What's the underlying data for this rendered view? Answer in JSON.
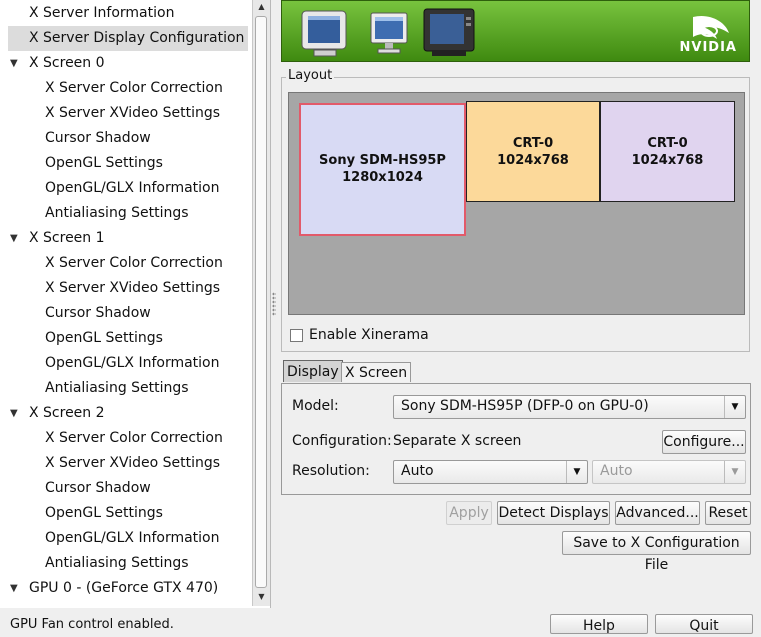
{
  "tree": {
    "items": [
      {
        "label": "X Server Information",
        "level": 1,
        "expander": false
      },
      {
        "label": "X Server Display Configuration",
        "level": 1,
        "expander": false,
        "selected": true
      },
      {
        "label": "X Screen 0",
        "level": 1,
        "expander": true
      },
      {
        "label": "X Server Color Correction",
        "level": 2
      },
      {
        "label": "X Server XVideo Settings",
        "level": 2
      },
      {
        "label": "Cursor Shadow",
        "level": 2
      },
      {
        "label": "OpenGL Settings",
        "level": 2
      },
      {
        "label": "OpenGL/GLX Information",
        "level": 2
      },
      {
        "label": "Antialiasing Settings",
        "level": 2
      },
      {
        "label": "X Screen 1",
        "level": 1,
        "expander": true
      },
      {
        "label": "X Server Color Correction",
        "level": 2
      },
      {
        "label": "X Server XVideo Settings",
        "level": 2
      },
      {
        "label": "Cursor Shadow",
        "level": 2
      },
      {
        "label": "OpenGL Settings",
        "level": 2
      },
      {
        "label": "OpenGL/GLX Information",
        "level": 2
      },
      {
        "label": "Antialiasing Settings",
        "level": 2
      },
      {
        "label": "X Screen 2",
        "level": 1,
        "expander": true
      },
      {
        "label": "X Server Color Correction",
        "level": 2
      },
      {
        "label": "X Server XVideo Settings",
        "level": 2
      },
      {
        "label": "Cursor Shadow",
        "level": 2
      },
      {
        "label": "OpenGL Settings",
        "level": 2
      },
      {
        "label": "OpenGL/GLX Information",
        "level": 2
      },
      {
        "label": "Antialiasing Settings",
        "level": 2
      },
      {
        "label": "GPU 0 - (GeForce GTX 470)",
        "level": 1,
        "expander": true
      }
    ]
  },
  "banner": {
    "brand": "NVIDIA"
  },
  "layout": {
    "label": "Layout",
    "displays": [
      {
        "name": "Sony SDM-HS95P",
        "resolution": "1280x1024",
        "color": "#d8daf4",
        "selected": true
      },
      {
        "name": "CRT-0",
        "resolution": "1024x768",
        "color": "#fcd99a"
      },
      {
        "name": "CRT-0",
        "resolution": "1024x768",
        "color": "#e0d4ef"
      }
    ],
    "xinerama_label": "Enable Xinerama",
    "xinerama_checked": false
  },
  "tabs": {
    "display": "Display",
    "xscreen": "X Screen"
  },
  "display_tab": {
    "model_label": "Model:",
    "model_value": "Sony SDM-HS95P (DFP-0 on GPU-0)",
    "config_label": "Configuration:",
    "config_value": "Separate X screen",
    "configure_button": "Configure...",
    "resolution_label": "Resolution:",
    "resolution_value": "Auto",
    "refresh_value": "Auto"
  },
  "buttons": {
    "apply": "Apply",
    "detect": "Detect Displays",
    "advanced": "Advanced...",
    "reset": "Reset",
    "save": "Save to X Configuration File",
    "help": "Help",
    "quit": "Quit"
  },
  "status": "GPU Fan control enabled.",
  "colors": {
    "selection_border": "#e25a6a",
    "banner_green": "#5aa524"
  }
}
